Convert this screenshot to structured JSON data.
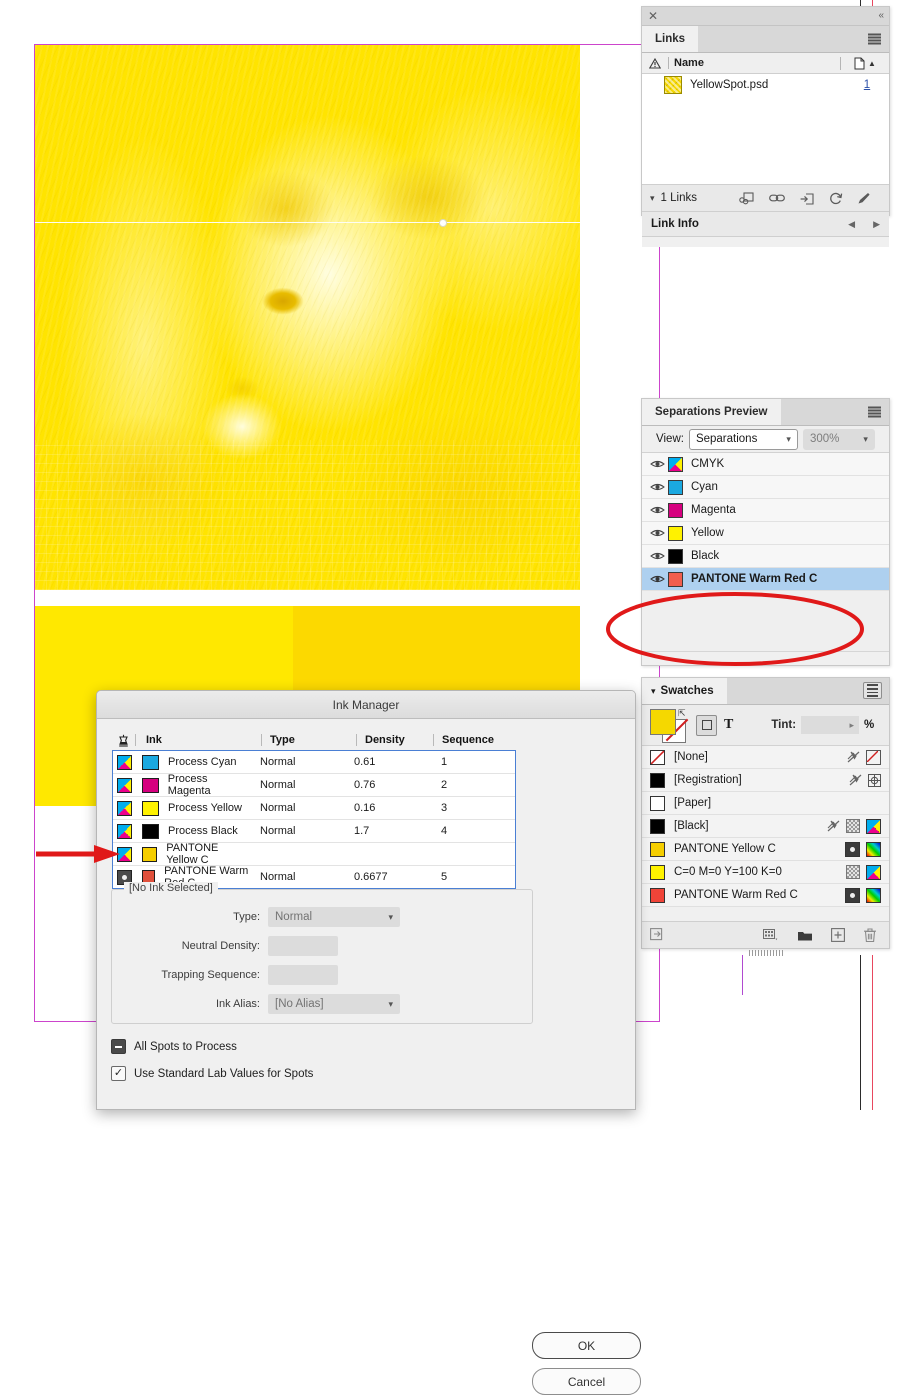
{
  "document": {
    "image_name": "dog-photo-yellow-separation",
    "bars": [
      {
        "name": "bar-left",
        "color": "#FFE800"
      },
      {
        "name": "bar-right",
        "color": "#FCD900"
      }
    ],
    "guide_color": "#CC44CC"
  },
  "annotations": {
    "arrow": {
      "name": "red-arrow-pointing-to-pantone-yellow-row",
      "color": "#E01919"
    },
    "ellipse": {
      "name": "red-ellipse-empty-separations-area",
      "color": "#E01919"
    }
  },
  "links_panel": {
    "tab_label": "Links",
    "columns": {
      "warn": "⚠",
      "name": "Name",
      "page": "Page"
    },
    "rows": [
      {
        "name": "YellowSpot.psd",
        "page": "1"
      }
    ],
    "footer": {
      "count": "1 Links"
    },
    "link_info_label": "Link Info",
    "icons": [
      "relink-icon",
      "go-to-link-icon",
      "update-link-icon",
      "refresh-icon",
      "edit-original-icon"
    ]
  },
  "separations_panel": {
    "tab_label": "Separations Preview",
    "view_label": "View:",
    "view_value": "Separations",
    "zoom_value": "300%",
    "rows": [
      {
        "label": "CMYK",
        "color": "#CMYK",
        "swatch": "cmyk",
        "visible": true,
        "selected": false
      },
      {
        "label": "Cyan",
        "color": "#1BA9E0",
        "swatch": "solid",
        "visible": true,
        "selected": false
      },
      {
        "label": "Magenta",
        "color": "#D6007F",
        "swatch": "solid",
        "visible": true,
        "selected": false
      },
      {
        "label": "Yellow",
        "color": "#FFF200",
        "swatch": "solid",
        "visible": true,
        "selected": false
      },
      {
        "label": "Black",
        "color": "#000000",
        "swatch": "solid",
        "visible": true,
        "selected": false
      },
      {
        "label": "PANTONE Warm Red C",
        "color": "#F15E4E",
        "swatch": "solid",
        "visible": true,
        "selected": true
      }
    ]
  },
  "swatches_panel": {
    "tab_label": "Swatches",
    "fill_color": "#F5D800",
    "tint_label": "Tint:",
    "tint_value": "",
    "percent_label": "%",
    "text_button_label": "T",
    "rows": [
      {
        "label": "[None]",
        "color": "none",
        "icons": [
          "no-print-icon",
          "none-icon"
        ]
      },
      {
        "label": "[Registration]",
        "color": "#000000",
        "icons": [
          "no-print-icon",
          "registration-icon"
        ]
      },
      {
        "label": "[Paper]",
        "color": "#FFFFFF",
        "icons": []
      },
      {
        "label": "[Black]",
        "color": "#000000",
        "icons": [
          "no-print-icon",
          "tint-icon",
          "cmyk-icon"
        ]
      },
      {
        "label": "PANTONE Yellow C",
        "color": "#F5CE00",
        "icons": [
          "spot-icon",
          "lab-icon"
        ]
      },
      {
        "label": "C=0 M=0 Y=100 K=0",
        "color": "#FFF200",
        "icons": [
          "tint-icon",
          "cmyk-icon"
        ]
      },
      {
        "label": "PANTONE Warm Red C",
        "color": "#F04438",
        "icons": [
          "spot-icon",
          "lab-icon"
        ]
      }
    ],
    "footer_icons": [
      "show-all-icon",
      "new-color-group-icon",
      "new-folder-icon",
      "new-swatch-icon",
      "delete-swatch-icon"
    ]
  },
  "ink_manager": {
    "title": "Ink Manager",
    "columns": [
      "",
      "Ink",
      "Type",
      "Density",
      "Sequence"
    ],
    "rows": [
      {
        "ink": "Process Cyan",
        "type": "Normal",
        "density": "0.61",
        "sequence": "1",
        "color": "#1BA9E0",
        "kind": "process"
      },
      {
        "ink": "Process Magenta",
        "type": "Normal",
        "density": "0.76",
        "sequence": "2",
        "color": "#D6007F",
        "kind": "process"
      },
      {
        "ink": "Process Yellow",
        "type": "Normal",
        "density": "0.16",
        "sequence": "3",
        "color": "#FFF200",
        "kind": "process"
      },
      {
        "ink": "Process Black",
        "type": "Normal",
        "density": "1.7",
        "sequence": "4",
        "color": "#000000",
        "kind": "process"
      },
      {
        "ink": "PANTONE Yellow C",
        "type": "",
        "density": "",
        "sequence": "",
        "color": "#F5CE00",
        "kind": "process"
      },
      {
        "ink": "PANTONE Warm Red C",
        "type": "Normal",
        "density": "0.6677",
        "sequence": "5",
        "color": "#E0503C",
        "kind": "spot"
      }
    ],
    "ok_label": "OK",
    "cancel_label": "Cancel",
    "fieldset_legend": "[No Ink Selected]",
    "fields": [
      {
        "label": "Type:",
        "value": "Normal",
        "kind": "dropdown"
      },
      {
        "label": "Neutral Density:",
        "value": "",
        "kind": "text"
      },
      {
        "label": "Trapping Sequence:",
        "value": "",
        "kind": "text"
      },
      {
        "label": "Ink Alias:",
        "value": "[No Alias]",
        "kind": "dropdown"
      }
    ],
    "checkboxes": [
      {
        "label": "All Spots to Process",
        "state": "mixed"
      },
      {
        "label": "Use Standard Lab Values for Spots",
        "state": "checked"
      }
    ]
  }
}
